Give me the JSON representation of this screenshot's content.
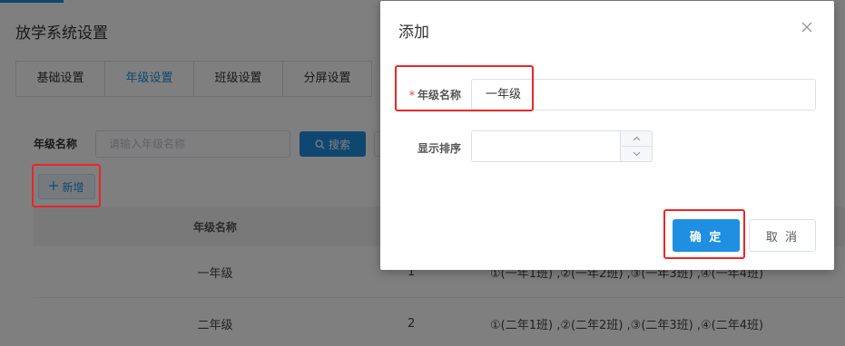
{
  "page": {
    "title": "放学系统设置",
    "tabs": [
      {
        "label": "基础设置",
        "active": false
      },
      {
        "label": "年级设置",
        "active": true
      },
      {
        "label": "班级设置",
        "active": false
      },
      {
        "label": "分屏设置",
        "active": false
      }
    ],
    "filter": {
      "label": "年级名称",
      "placeholder": "请输入年级名称",
      "search_label": "搜索"
    },
    "add_label": "新增",
    "table": {
      "headers": [
        "年级名称",
        "",
        ""
      ],
      "rows": [
        {
          "name": "一年级",
          "order": "1",
          "classes": "①(一年1班) ,②(一年2班) ,③(一年3班) ,④(一年4班)"
        },
        {
          "name": "二年级",
          "order": "2",
          "classes": "①(二年1班) ,②(二年2班) ,③(二年3班) ,④(二年4班)"
        }
      ]
    }
  },
  "dialog": {
    "title": "添加",
    "fields": {
      "grade_name": {
        "required_mark": "*",
        "label": "年级名称",
        "value": "一年级"
      },
      "display_order": {
        "label": "显示排序",
        "value": ""
      }
    },
    "confirm_label": "确 定",
    "cancel_label": "取 消"
  },
  "colors": {
    "primary": "#1e8fe1",
    "highlight": "#e8262a",
    "required": "#f56c6c"
  }
}
